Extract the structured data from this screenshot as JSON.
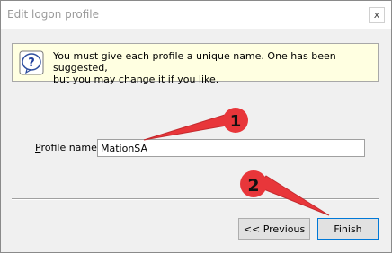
{
  "window": {
    "title": "Edit logon profile",
    "close_label": "x"
  },
  "info": {
    "line1": "You must give each profile a unique name.  One has been suggested,",
    "line2": "but you may change it if you like."
  },
  "profile": {
    "label_mnemonic": "P",
    "label_rest": "rofile name:",
    "value": "MationSA"
  },
  "buttons": {
    "previous_label": "<< Previous",
    "finish_label": "Finish"
  },
  "annotations": {
    "marker1": "1",
    "marker2": "2",
    "color": "#e8363a"
  }
}
